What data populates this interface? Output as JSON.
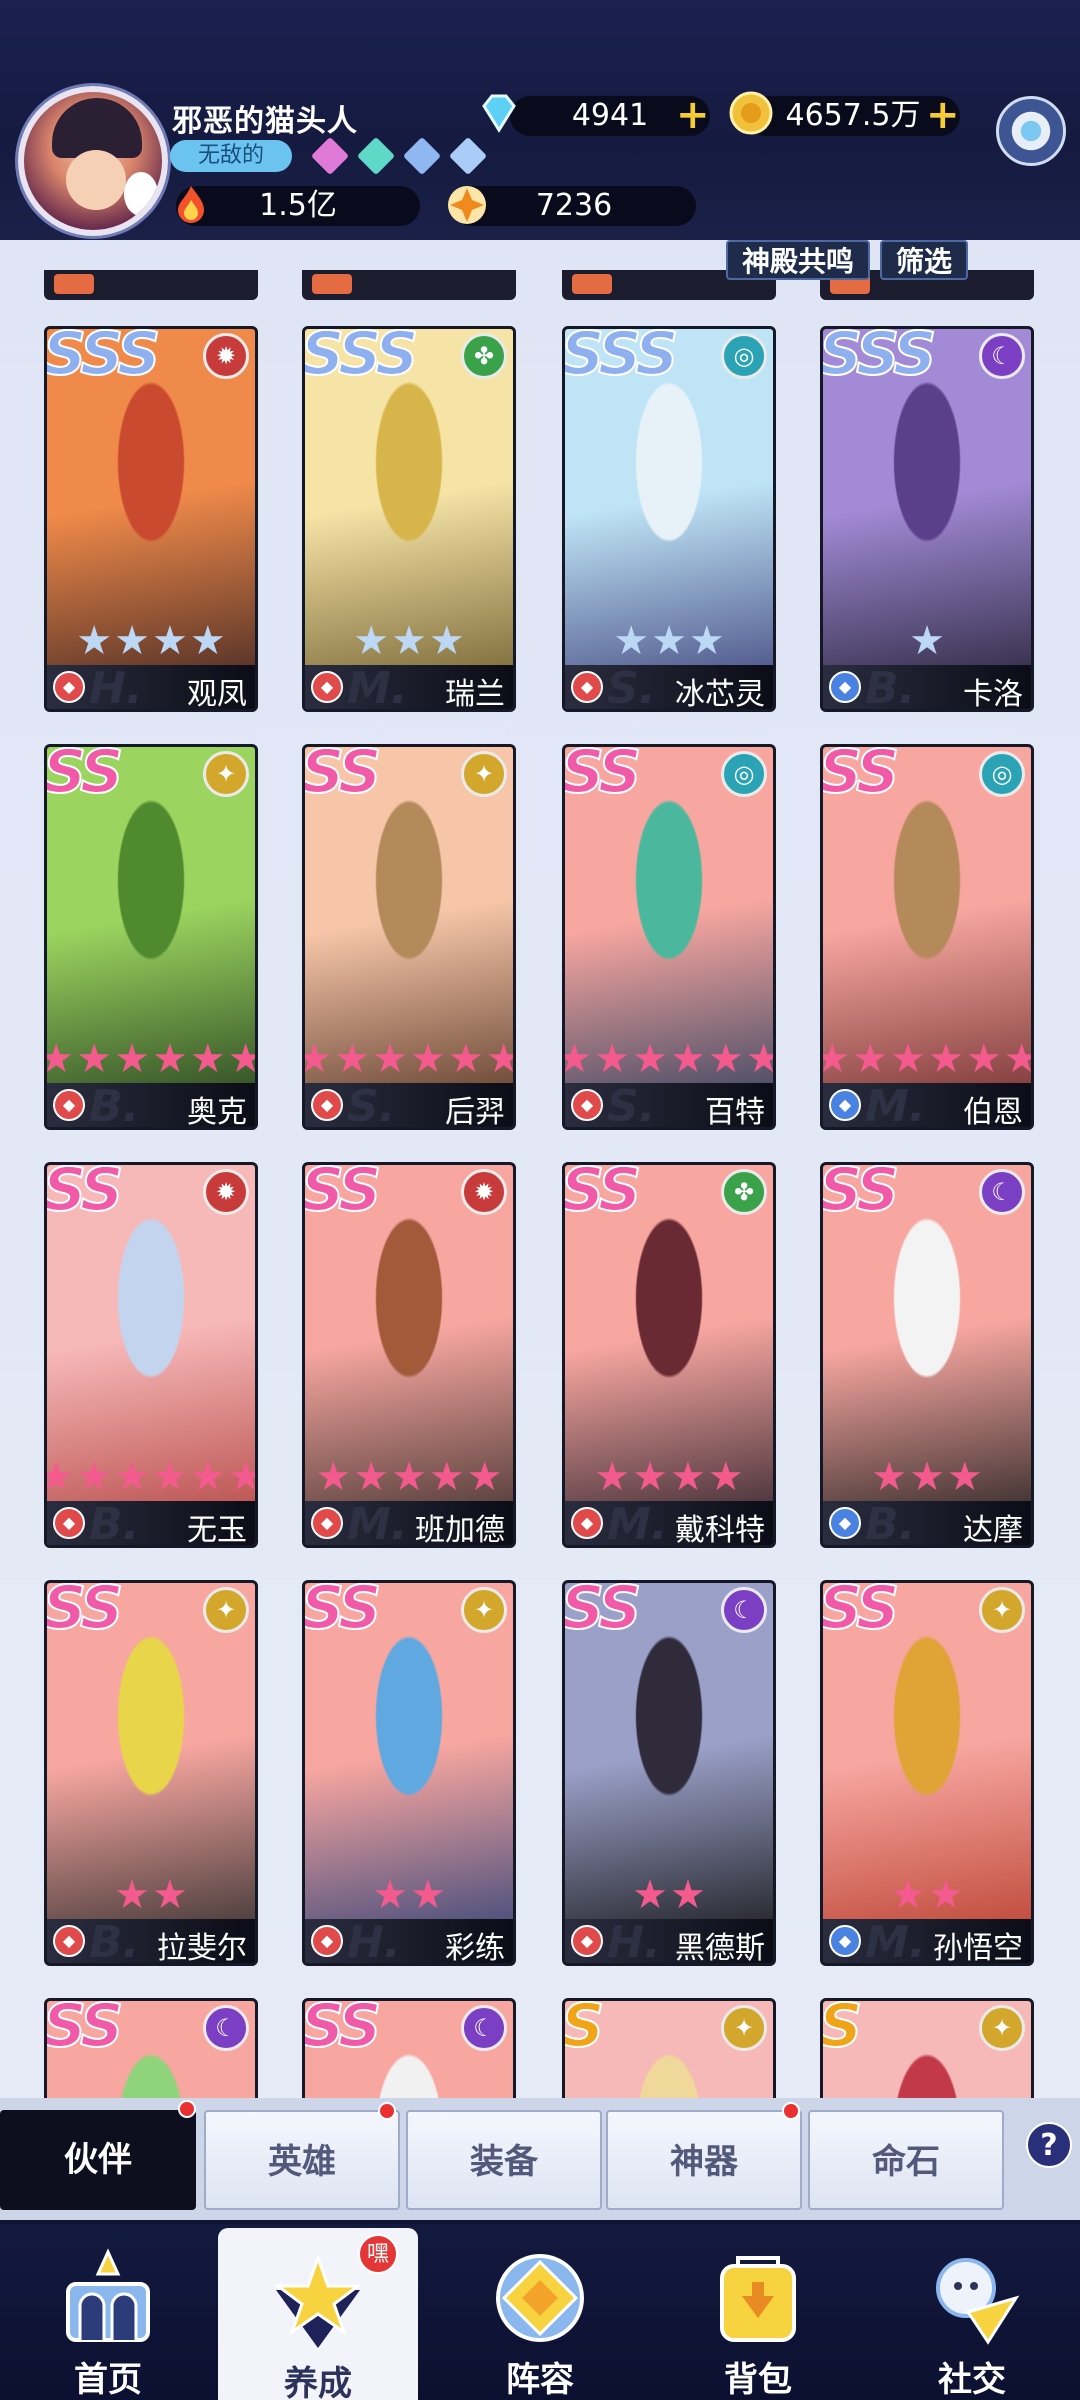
{
  "player": {
    "name": "邪恶的猫头人",
    "title": "无敌的",
    "power": "1.5亿",
    "energy": "7236"
  },
  "currencies": {
    "diamonds": "4941",
    "gold": "4657.5万"
  },
  "toolbar": {
    "resonance_label": "神殿共鸣",
    "filter_label": "筛选"
  },
  "colors": {
    "sss_rank": "#8fb0ef",
    "ss_rank": "#f05aa7",
    "s_rank": "#f0a418",
    "card_pink": "#f7a6a0",
    "star_blue": "#bcd8f4",
    "star_pink": "#f35a8d",
    "elem_fire": "#c83b3b",
    "elem_nature": "#3aa34a",
    "elem_water": "#2aa3b4",
    "elem_dark": "#7b3fc3",
    "elem_light": "#d3a72c"
  },
  "heroes": [
    {
      "rank": "SSS",
      "name": "观凤",
      "element": "fire-element-icon",
      "stars": 4,
      "star_color": "blue",
      "race": "H."
    },
    {
      "rank": "SSS",
      "name": "瑞兰",
      "element": "nature-element-icon",
      "stars": 3,
      "star_color": "blue",
      "race": "M."
    },
    {
      "rank": "SSS",
      "name": "冰芯灵",
      "element": "water-element-icon",
      "stars": 3,
      "star_color": "blue",
      "race": "S."
    },
    {
      "rank": "SSS",
      "name": "卡洛",
      "element": "dark-element-icon",
      "stars": 1,
      "star_color": "blue",
      "race": "B."
    },
    {
      "rank": "SS",
      "name": "奥克",
      "element": "light-element-icon",
      "stars": 6,
      "star_color": "pink",
      "race": "B."
    },
    {
      "rank": "SS",
      "name": "后羿",
      "element": "light-element-icon",
      "stars": 6,
      "star_color": "pink",
      "race": "S."
    },
    {
      "rank": "SS",
      "name": "百特",
      "element": "water-element-icon",
      "stars": 6,
      "star_color": "pink",
      "race": "S."
    },
    {
      "rank": "SS",
      "name": "伯恩",
      "element": "water-element-icon",
      "stars": 6,
      "star_color": "pink",
      "race": "M."
    },
    {
      "rank": "SS",
      "name": "无玉",
      "element": "fire-element-icon",
      "stars": 6,
      "star_color": "pink",
      "race": "B."
    },
    {
      "rank": "SS",
      "name": "班加德",
      "element": "fire-element-icon",
      "stars": 5,
      "star_color": "pink",
      "race": "M."
    },
    {
      "rank": "SS",
      "name": "戴科特",
      "element": "nature-element-icon",
      "stars": 4,
      "star_color": "pink",
      "race": "M."
    },
    {
      "rank": "SS",
      "name": "达摩",
      "element": "dark-element-icon",
      "stars": 3,
      "star_color": "pink",
      "race": "B."
    },
    {
      "rank": "SS",
      "name": "拉斐尔",
      "element": "light-element-icon",
      "stars": 2,
      "star_color": "pink",
      "race": "B."
    },
    {
      "rank": "SS",
      "name": "彩练",
      "element": "light-element-icon",
      "stars": 2,
      "star_color": "pink",
      "race": "H."
    },
    {
      "rank": "SS",
      "name": "黑德斯",
      "element": "dark-element-icon",
      "stars": 2,
      "star_color": "pink",
      "race": "H."
    },
    {
      "rank": "SS",
      "name": "孙悟空",
      "element": "light-element-icon",
      "stars": 2,
      "star_color": "pink",
      "race": "M."
    },
    {
      "rank": "SS",
      "name": "",
      "element": "dark-element-icon",
      "stars": 0,
      "star_color": "pink",
      "race": ""
    },
    {
      "rank": "SS",
      "name": "",
      "element": "dark-element-icon",
      "stars": 0,
      "star_color": "pink",
      "race": ""
    },
    {
      "rank": "S",
      "name": "",
      "element": "light-element-icon",
      "stars": 0,
      "star_color": "pink",
      "race": ""
    },
    {
      "rank": "S",
      "name": "",
      "element": "light-element-icon",
      "stars": 0,
      "star_color": "pink",
      "race": ""
    }
  ],
  "subtabs": [
    {
      "label": "伙伴",
      "active": true,
      "dot": true
    },
    {
      "label": "英雄",
      "active": false,
      "dot": true
    },
    {
      "label": "装备",
      "active": false,
      "dot": false
    },
    {
      "label": "神器",
      "active": false,
      "dot": true
    },
    {
      "label": "命石",
      "active": false,
      "dot": false
    }
  ],
  "help_label": "?",
  "nav": [
    {
      "label": "首页",
      "icon": "castle-icon",
      "active": false
    },
    {
      "label": "养成",
      "icon": "star-upgrade-icon",
      "active": true,
      "badge": "嘿"
    },
    {
      "label": "阵容",
      "icon": "formation-icon",
      "active": false
    },
    {
      "label": "背包",
      "icon": "bag-icon",
      "active": false
    },
    {
      "label": "社交",
      "icon": "social-icon",
      "active": false
    }
  ]
}
